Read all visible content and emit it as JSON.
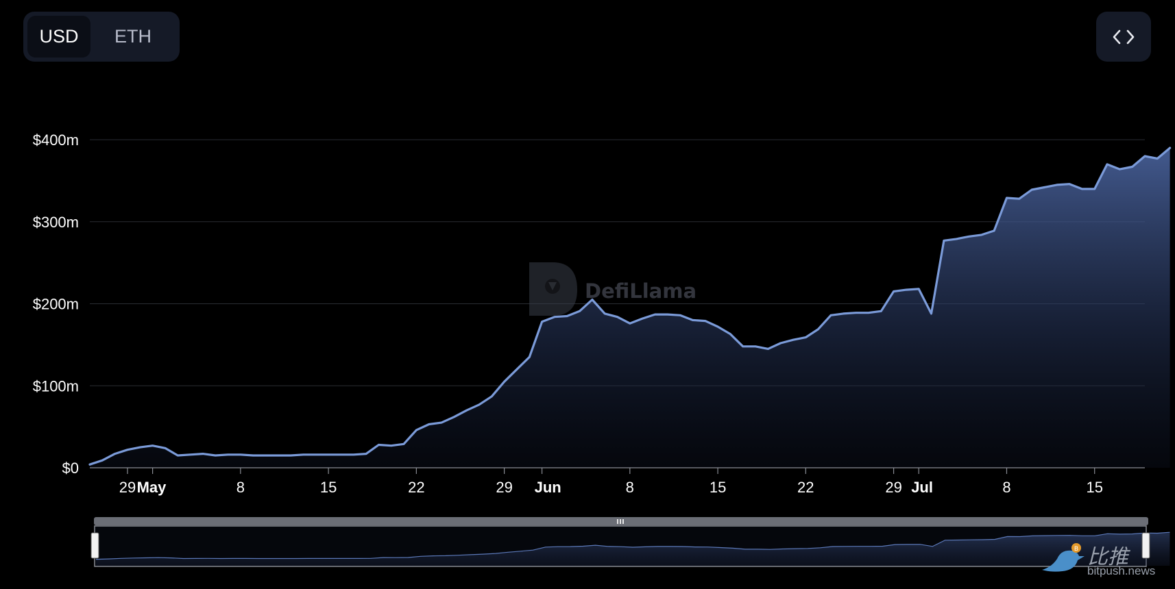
{
  "currency_toggle": {
    "options": [
      {
        "label": "USD",
        "active": true
      },
      {
        "label": "ETH",
        "active": false
      }
    ]
  },
  "embed_button": {
    "icon": "code-brackets-icon"
  },
  "chart_data": {
    "type": "area",
    "title": "",
    "xlabel": "",
    "ylabel": "",
    "ylim": [
      0,
      400
    ],
    "y_unit": "m USD",
    "y_ticks": [
      {
        "value": 0,
        "label": "$0"
      },
      {
        "value": 100,
        "label": "$100m"
      },
      {
        "value": 200,
        "label": "$200m"
      },
      {
        "value": 300,
        "label": "$300m"
      },
      {
        "value": 400,
        "label": "$400m"
      }
    ],
    "x_range": [
      "2024-04-26",
      "2024-07-19"
    ],
    "x_ticks": [
      {
        "date": "2024-04-29",
        "label": "29",
        "bold": false
      },
      {
        "date": "2024-05-01",
        "label": "May",
        "bold": true
      },
      {
        "date": "2024-05-08",
        "label": "8",
        "bold": false
      },
      {
        "date": "2024-05-15",
        "label": "15",
        "bold": false
      },
      {
        "date": "2024-05-22",
        "label": "22",
        "bold": false
      },
      {
        "date": "2024-05-29",
        "label": "29",
        "bold": false
      },
      {
        "date": "2024-06-01",
        "label": "Jun",
        "bold": true
      },
      {
        "date": "2024-06-08",
        "label": "8",
        "bold": false
      },
      {
        "date": "2024-06-15",
        "label": "15",
        "bold": false
      },
      {
        "date": "2024-06-22",
        "label": "22",
        "bold": false
      },
      {
        "date": "2024-06-29",
        "label": "29",
        "bold": false
      },
      {
        "date": "2024-07-01",
        "label": "Jul",
        "bold": true
      },
      {
        "date": "2024-07-08",
        "label": "8",
        "bold": false
      },
      {
        "date": "2024-07-15",
        "label": "15",
        "bold": false
      }
    ],
    "grid": true,
    "line_color": "#7b9bd9",
    "fill_color": "#4f6aa8",
    "series": [
      {
        "points": [
          [
            "2024-04-26",
            4
          ],
          [
            "2024-04-27",
            9
          ],
          [
            "2024-04-28",
            17
          ],
          [
            "2024-04-29",
            22
          ],
          [
            "2024-04-30",
            25
          ],
          [
            "2024-05-01",
            27
          ],
          [
            "2024-05-02",
            24
          ],
          [
            "2024-05-03",
            15
          ],
          [
            "2024-05-04",
            16
          ],
          [
            "2024-05-05",
            17
          ],
          [
            "2024-05-06",
            15
          ],
          [
            "2024-05-07",
            16
          ],
          [
            "2024-05-08",
            16
          ],
          [
            "2024-05-09",
            15
          ],
          [
            "2024-05-10",
            15
          ],
          [
            "2024-05-11",
            15
          ],
          [
            "2024-05-12",
            15
          ],
          [
            "2024-05-13",
            16
          ],
          [
            "2024-05-14",
            16
          ],
          [
            "2024-05-15",
            16
          ],
          [
            "2024-05-16",
            16
          ],
          [
            "2024-05-17",
            16
          ],
          [
            "2024-05-18",
            17
          ],
          [
            "2024-05-19",
            28
          ],
          [
            "2024-05-20",
            27
          ],
          [
            "2024-05-21",
            29
          ],
          [
            "2024-05-22",
            46
          ],
          [
            "2024-05-23",
            53
          ],
          [
            "2024-05-24",
            55
          ],
          [
            "2024-05-25",
            62
          ],
          [
            "2024-05-26",
            70
          ],
          [
            "2024-05-27",
            77
          ],
          [
            "2024-05-28",
            87
          ],
          [
            "2024-05-29",
            105
          ],
          [
            "2024-05-30",
            120
          ],
          [
            "2024-05-31",
            135
          ],
          [
            "2024-06-01",
            178
          ],
          [
            "2024-06-02",
            184
          ],
          [
            "2024-06-03",
            185
          ],
          [
            "2024-06-04",
            191
          ],
          [
            "2024-06-05",
            205
          ],
          [
            "2024-06-06",
            188
          ],
          [
            "2024-06-07",
            184
          ],
          [
            "2024-06-08",
            176
          ],
          [
            "2024-06-09",
            182
          ],
          [
            "2024-06-10",
            187
          ],
          [
            "2024-06-11",
            187
          ],
          [
            "2024-06-12",
            186
          ],
          [
            "2024-06-13",
            180
          ],
          [
            "2024-06-14",
            179
          ],
          [
            "2024-06-15",
            172
          ],
          [
            "2024-06-16",
            163
          ],
          [
            "2024-06-17",
            148
          ],
          [
            "2024-06-18",
            148
          ],
          [
            "2024-06-19",
            145
          ],
          [
            "2024-06-20",
            152
          ],
          [
            "2024-06-21",
            156
          ],
          [
            "2024-06-22",
            159
          ],
          [
            "2024-06-23",
            169
          ],
          [
            "2024-06-24",
            186
          ],
          [
            "2024-06-25",
            188
          ],
          [
            "2024-06-26",
            189
          ],
          [
            "2024-06-27",
            189
          ],
          [
            "2024-06-28",
            191
          ],
          [
            "2024-06-29",
            215
          ],
          [
            "2024-06-30",
            217
          ],
          [
            "2024-07-01",
            218
          ],
          [
            "2024-07-02",
            188
          ],
          [
            "2024-07-03",
            277
          ],
          [
            "2024-07-04",
            279
          ],
          [
            "2024-07-05",
            282
          ],
          [
            "2024-07-06",
            284
          ],
          [
            "2024-07-07",
            289
          ],
          [
            "2024-07-08",
            329
          ],
          [
            "2024-07-09",
            328
          ],
          [
            "2024-07-10",
            339
          ],
          [
            "2024-07-11",
            342
          ],
          [
            "2024-07-12",
            345
          ],
          [
            "2024-07-13",
            346
          ],
          [
            "2024-07-14",
            340
          ],
          [
            "2024-07-15",
            340
          ],
          [
            "2024-07-16",
            370
          ],
          [
            "2024-07-17",
            364
          ],
          [
            "2024-07-18",
            367
          ],
          [
            "2024-07-19",
            380
          ],
          [
            "2024-07-20",
            377
          ],
          [
            "2024-07-21",
            390
          ]
        ]
      }
    ],
    "center_watermark": "DefiLlama"
  },
  "source_watermark": {
    "cn_text": "比推",
    "en_text": "bitpush.news"
  }
}
